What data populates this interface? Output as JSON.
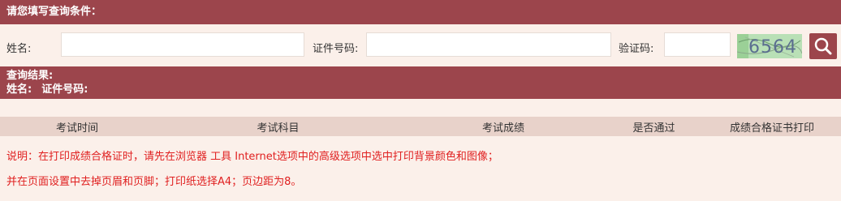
{
  "criteria_header": "请您填写查询条件：",
  "form": {
    "name_label": "姓名:",
    "name_value": "",
    "id_label": "证件号码:",
    "id_value": "",
    "captcha_label": "验证码:",
    "captcha_value": "",
    "captcha_text": "6564"
  },
  "icons": {
    "search": "magnifier-icon"
  },
  "results": {
    "header": "查询结果:",
    "name_label": "姓名:",
    "id_label": "证件号码:"
  },
  "table": {
    "columns": [
      "考试时间",
      "考试科目",
      "考试成绩",
      "是否通过",
      "成绩合格证书打印"
    ]
  },
  "notes": [
    "说明：在打印成绩合格证时，请先在浏览器 工具 Internet选项中的高级选项中选中打印背景颜色和图像；",
    "并在页面设置中去掉页眉和页脚；打印纸选择A4；页边距为8。"
  ],
  "colors": {
    "accent": "#9c454c",
    "background": "#fbf0ea",
    "table_header": "#e8d2ca",
    "note_text": "#e02020"
  }
}
